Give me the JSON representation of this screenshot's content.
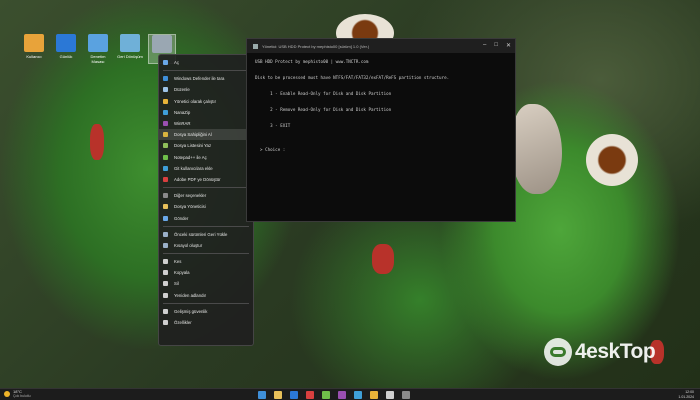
{
  "desktop": {
    "icons": [
      {
        "label": "Kullanıcı",
        "icon": "user-folder-icon",
        "color": "#e8a33a"
      },
      {
        "label": "Günlük",
        "icon": "monitor-icon",
        "color": "#2b78d6"
      },
      {
        "label": "Denetim Masası",
        "icon": "control-panel-icon",
        "color": "#5aa2e0"
      },
      {
        "label": "Geri Dönüşüm",
        "icon": "recycle-bin-icon",
        "color": "#6fb0d8"
      },
      {
        "label": "",
        "icon": "settings-app-icon",
        "color": "#9aa7b2"
      }
    ]
  },
  "context_menu": {
    "items": [
      {
        "label": "Aç",
        "icon": "open-icon",
        "color": "#6aa8e8",
        "arrow": false
      },
      {
        "label": "Windows Defender ile tara",
        "icon": "shield-icon",
        "color": "#3f8fd8",
        "arrow": true
      },
      {
        "label": "Düzenle",
        "icon": "edit-icon",
        "color": "#9ec4e8",
        "arrow": false
      },
      {
        "label": "Yönetici olarak çalıştır",
        "icon": "admin-shield-icon",
        "color": "#e8b339",
        "arrow": false
      },
      {
        "label": "NanaZip",
        "icon": "archive-icon",
        "color": "#3f9fd8",
        "arrow": true
      },
      {
        "label": "WinRAR",
        "icon": "winrar-icon",
        "color": "#9a4fb0",
        "arrow": true
      },
      {
        "label": "Dosya Sahipliğini Al",
        "icon": "ownership-icon",
        "color": "#d8b43f",
        "arrow": false
      },
      {
        "label": "Dosya Listesini Yaz",
        "icon": "list-icon",
        "color": "#8fbf5a",
        "arrow": false
      },
      {
        "label": "Notepad++ ile Aç",
        "icon": "notepad-icon",
        "color": "#6fbf4a",
        "arrow": false
      },
      {
        "label": "Git kullanıcılara ekle",
        "icon": "git-icon",
        "color": "#3f9fd8",
        "arrow": false
      },
      {
        "label": "Adobe PDF ye Dönüştür",
        "icon": "pdf-icon",
        "color": "#d83f3f",
        "arrow": false
      },
      {
        "label": "Diğer seçenekler",
        "icon": "more-icon",
        "color": "#8a8a8a",
        "arrow": true
      },
      {
        "label": "Dosya Yöneticisi",
        "icon": "folder-icon",
        "color": "#e8c05a",
        "arrow": true
      },
      {
        "label": "Gönder",
        "icon": "send-icon",
        "color": "#6aa8e8",
        "arrow": true
      },
      {
        "label": "Önceki sürümleri Geri Yükle",
        "icon": "restore-icon",
        "color": "#9ab0c8",
        "arrow": false
      },
      {
        "label": "Kısayol oluştur",
        "icon": "shortcut-icon",
        "color": "#9ab0c8",
        "arrow": false
      },
      {
        "label": "Kes",
        "icon": "cut-icon",
        "color": "#cfcfcf",
        "arrow": false
      },
      {
        "label": "Kopyala",
        "icon": "copy-icon",
        "color": "#cfcfcf",
        "arrow": false
      },
      {
        "label": "Sil",
        "icon": "delete-icon",
        "color": "#cfcfcf",
        "arrow": false
      },
      {
        "label": "Yeniden adlandır",
        "icon": "rename-icon",
        "color": "#cfcfcf",
        "arrow": false
      },
      {
        "label": "Gelişmiş güvenlik",
        "icon": "security-icon",
        "color": "#cfcfcf",
        "arrow": false
      },
      {
        "label": "Özellikler",
        "icon": "properties-icon",
        "color": "#cfcfcf",
        "arrow": false
      }
    ],
    "hover_index": 6,
    "separators_after": [
      0,
      10,
      13,
      15,
      19
    ]
  },
  "terminal": {
    "title": "Yönetici: USB HDD Protect by mephisto00 [sürüm] 1.0 (Ver.)",
    "lines": [
      "USB HDD Protect by mephisto00 | www.TNCTR.com",
      "",
      "Disk to be processed must have NTFS/FAT/FAT32/exFAT/ReFS partition structure.",
      "",
      "      1 - Enable Read-Only for Disk and Disk Partition",
      "",
      "      2 - Remove Read-Only for Disk and Disk Partition",
      "",
      "      3 - EXIT",
      "",
      "",
      "  > Choice :"
    ]
  },
  "watermark": {
    "text": "4eskTop"
  },
  "taskbar": {
    "weather_temp": "18°C",
    "weather_cond": "Çok bulutlu",
    "time": "12:00",
    "date": "1.01.2024",
    "apps": [
      "#3f8fd8",
      "#e8c05a",
      "#2b78d6",
      "#d83f3f",
      "#6fbf4a",
      "#9a4fb0",
      "#3f9fd8",
      "#e8b339",
      "#cfcfcf",
      "#8a8a8a"
    ]
  }
}
